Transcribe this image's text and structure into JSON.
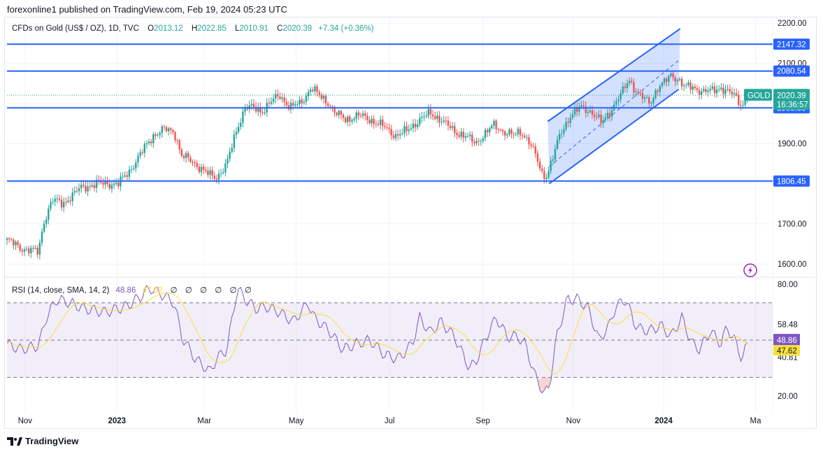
{
  "publisher": "forexonline1 published on TradingView.com, Feb 19, 2024 05:23 UTC",
  "legend": {
    "title": "CFDs on Gold (US$ / OZ), 1D, TVC",
    "o_label": "O",
    "open": "2013.12",
    "h_label": "H",
    "high": "2022.85",
    "l_label": "L",
    "low": "2010.91",
    "c_label": "C",
    "close": "2020.39",
    "change": "+7.34 (+0.36%)"
  },
  "rsi_legend": {
    "title": "RSI (14, close, SMA, 14, 2)",
    "rsi": "48.86",
    "sma": "47.62",
    "empty": [
      "∅",
      "∅",
      "∅",
      "∅",
      "∅",
      "∅"
    ]
  },
  "footer": {
    "brand": "TradingView"
  },
  "colors": {
    "up": "#26a69a",
    "down": "#ef5350",
    "level": "#2962ff",
    "rsi": "#7e57c2",
    "sma": "#f7e03b"
  },
  "chart_data": [
    {
      "type": "candlestick",
      "title": "CFDs on Gold (US$ / OZ), 1D, TVC",
      "symbol": "GOLD",
      "start_date": "2022-10-20",
      "x_unit": "days since start_date",
      "ylim": [
        1600,
        2200
      ],
      "y_ticks": [
        "2200.00",
        "2100.00",
        "1900.00",
        "1700.00",
        "1600.00"
      ],
      "x_ticks": [
        {
          "day": 12,
          "label": "Nov"
        },
        {
          "day": 73,
          "label": "2023"
        },
        {
          "day": 131,
          "label": "Mar"
        },
        {
          "day": 192,
          "label": "May"
        },
        {
          "day": 254,
          "label": "Jul"
        },
        {
          "day": 316,
          "label": "Sep"
        },
        {
          "day": 376,
          "label": "Nov"
        },
        {
          "day": 436,
          "label": "2024"
        },
        {
          "day": 497,
          "label": "Ma"
        }
      ],
      "close_path": [
        [
          0,
          1660
        ],
        [
          9,
          1640
        ],
        [
          21,
          1630
        ],
        [
          24,
          1700
        ],
        [
          30,
          1760
        ],
        [
          37,
          1750
        ],
        [
          49,
          1790
        ],
        [
          60,
          1800
        ],
        [
          74,
          1800
        ],
        [
          81,
          1830
        ],
        [
          88,
          1870
        ],
        [
          97,
          1920
        ],
        [
          104,
          1935
        ],
        [
          111,
          1930
        ],
        [
          116,
          1870
        ],
        [
          125,
          1850
        ],
        [
          135,
          1820
        ],
        [
          139,
          1815
        ],
        [
          146,
          1850
        ],
        [
          153,
          1940
        ],
        [
          158,
          1990
        ],
        [
          162,
          1990
        ],
        [
          169,
          1980
        ],
        [
          174,
          2000
        ],
        [
          181,
          2020
        ],
        [
          188,
          1990
        ],
        [
          195,
          2000
        ],
        [
          202,
          2040
        ],
        [
          207,
          2020
        ],
        [
          214,
          2000
        ],
        [
          218,
          1975
        ],
        [
          225,
          1960
        ],
        [
          234,
          1970
        ],
        [
          241,
          1960
        ],
        [
          251,
          1940
        ],
        [
          258,
          1920
        ],
        [
          265,
          1930
        ],
        [
          274,
          1960
        ],
        [
          281,
          1975
        ],
        [
          288,
          1960
        ],
        [
          297,
          1930
        ],
        [
          304,
          1920
        ],
        [
          311,
          1900
        ],
        [
          316,
          1920
        ],
        [
          323,
          1945
        ],
        [
          330,
          1930
        ],
        [
          337,
          1920
        ],
        [
          341,
          1930
        ],
        [
          346,
          1910
        ],
        [
          351,
          1870
        ],
        [
          355,
          1825
        ],
        [
          358,
          1820
        ],
        [
          362,
          1860
        ],
        [
          367,
          1920
        ],
        [
          374,
          1970
        ],
        [
          381,
          1990
        ],
        [
          388,
          1980
        ],
        [
          395,
          1950
        ],
        [
          402,
          1990
        ],
        [
          409,
          2030
        ],
        [
          413,
          2060
        ],
        [
          418,
          2030
        ],
        [
          423,
          2010
        ],
        [
          427,
          2000
        ],
        [
          432,
          2040
        ],
        [
          436,
          2050
        ],
        [
          441,
          2070
        ],
        [
          446,
          2060
        ],
        [
          450,
          2040
        ],
        [
          455,
          2040
        ],
        [
          462,
          2030
        ],
        [
          467,
          2030
        ],
        [
          474,
          2040
        ],
        [
          478,
          2030
        ],
        [
          483,
          2020
        ],
        [
          488,
          1995
        ],
        [
          492,
          2020.39
        ]
      ],
      "levels": [
        {
          "price": 2147.32,
          "label": "2147.32"
        },
        {
          "price": 2080.54,
          "label": "2080.54"
        },
        {
          "price": 1988.85,
          "label": "1988.85"
        },
        {
          "price": 1806.45,
          "label": "1806.45"
        }
      ],
      "last_price": {
        "label": "2020.39",
        "countdown": "16:36:57",
        "price": 2020.39
      },
      "channel": {
        "lower": [
          [
            360,
            1800
          ],
          [
            446,
            2035
          ]
        ],
        "upper": [
          [
            359,
            1955
          ],
          [
            447,
            2186
          ]
        ]
      }
    },
    {
      "type": "line",
      "title": "RSI (14, close, SMA, 14, 2)",
      "ylim": [
        15,
        82
      ],
      "bands": {
        "upper": 70,
        "middle": 50,
        "lower": 30
      },
      "y_ticks": [
        "80.00",
        "58.48",
        "40.81",
        "20.00"
      ],
      "last_values": {
        "rsi": "48.86",
        "sma": "47.62"
      },
      "rsi_path": [
        [
          0,
          48
        ],
        [
          9,
          45
        ],
        [
          21,
          47
        ],
        [
          26,
          62
        ],
        [
          33,
          72
        ],
        [
          42,
          70
        ],
        [
          51,
          67
        ],
        [
          65,
          65
        ],
        [
          79,
          68
        ],
        [
          88,
          73
        ],
        [
          95,
          78
        ],
        [
          104,
          74
        ],
        [
          111,
          70
        ],
        [
          116,
          52
        ],
        [
          125,
          40
        ],
        [
          135,
          33
        ],
        [
          139,
          40
        ],
        [
          146,
          45
        ],
        [
          153,
          78
        ],
        [
          158,
          72
        ],
        [
          165,
          67
        ],
        [
          172,
          68
        ],
        [
          181,
          65
        ],
        [
          190,
          60
        ],
        [
          200,
          70
        ],
        [
          204,
          62
        ],
        [
          214,
          55
        ],
        [
          223,
          45
        ],
        [
          232,
          48
        ],
        [
          241,
          50
        ],
        [
          251,
          42
        ],
        [
          260,
          40
        ],
        [
          269,
          48
        ],
        [
          274,
          62
        ],
        [
          281,
          54
        ],
        [
          288,
          60
        ],
        [
          297,
          52
        ],
        [
          307,
          35
        ],
        [
          311,
          38
        ],
        [
          320,
          55
        ],
        [
          325,
          62
        ],
        [
          332,
          52
        ],
        [
          339,
          52
        ],
        [
          344,
          48
        ],
        [
          351,
          30
        ],
        [
          357,
          21
        ],
        [
          360,
          25
        ],
        [
          365,
          52
        ],
        [
          372,
          72
        ],
        [
          379,
          72
        ],
        [
          386,
          67
        ],
        [
          393,
          50
        ],
        [
          400,
          58
        ],
        [
          404,
          68
        ],
        [
          411,
          72
        ],
        [
          416,
          60
        ],
        [
          420,
          56
        ],
        [
          427,
          55
        ],
        [
          434,
          58
        ],
        [
          441,
          52
        ],
        [
          448,
          62
        ],
        [
          455,
          48
        ],
        [
          460,
          45
        ],
        [
          467,
          55
        ],
        [
          474,
          48
        ],
        [
          478,
          57
        ],
        [
          483,
          50
        ],
        [
          488,
          40
        ],
        [
          492,
          48.86
        ]
      ]
    }
  ]
}
